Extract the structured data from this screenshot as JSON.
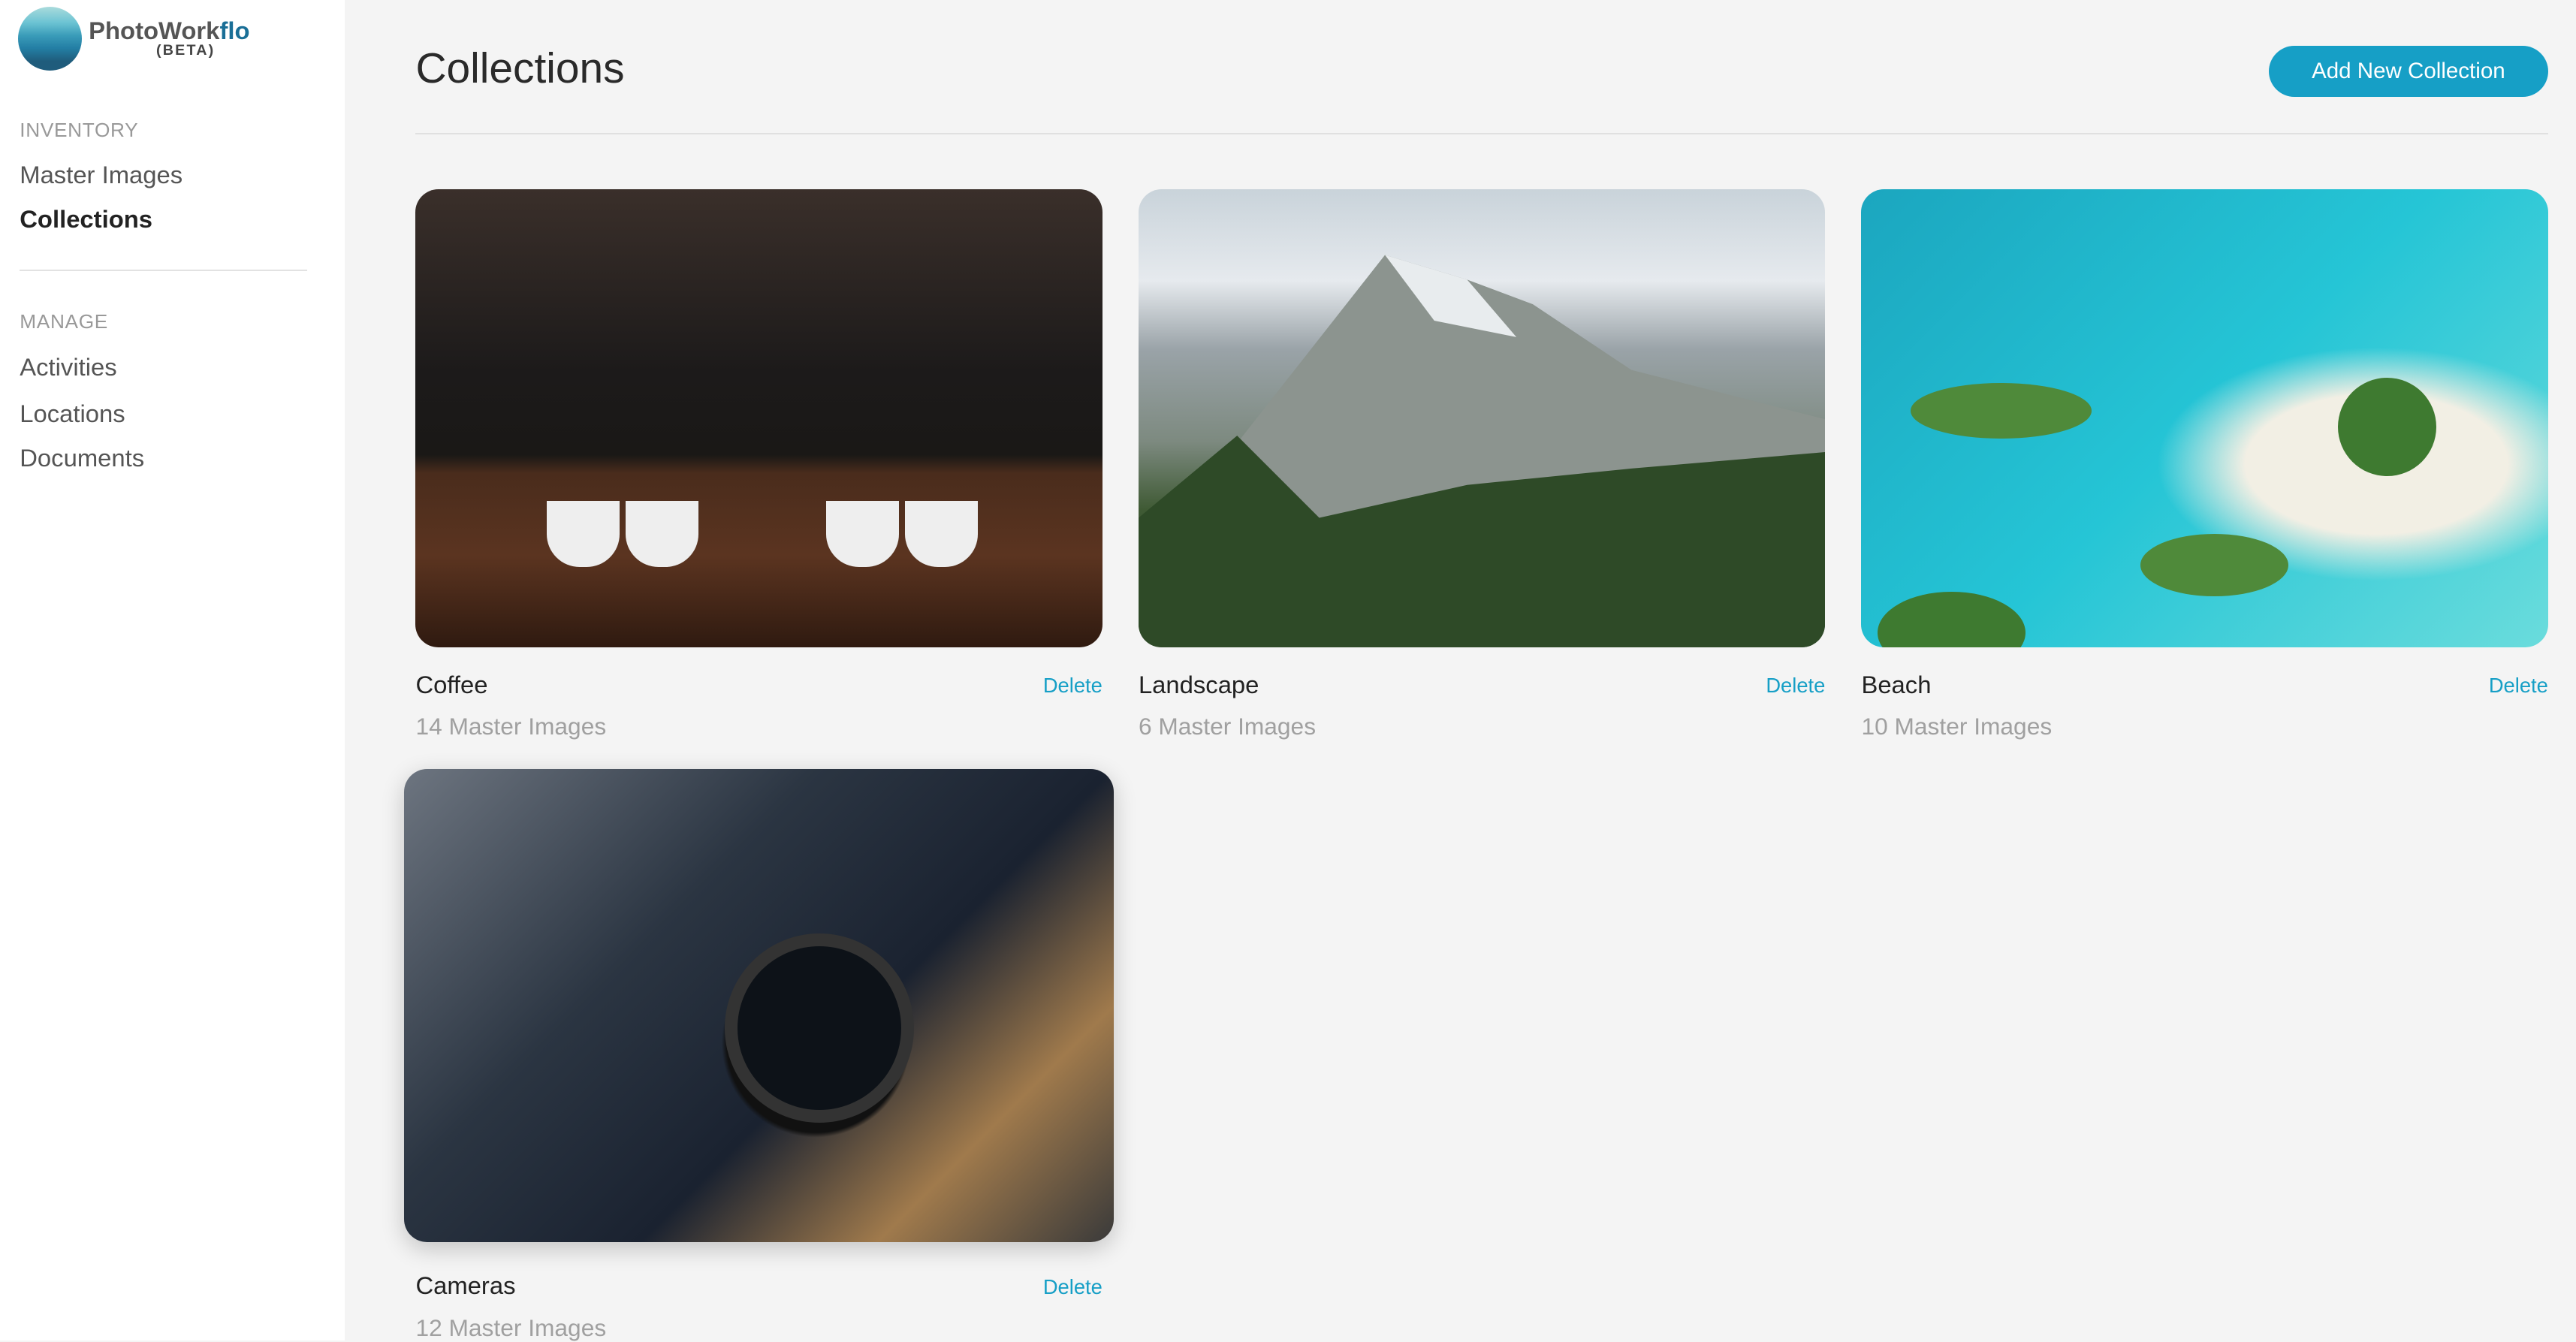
{
  "app": {
    "name_part1": "PhotoWork",
    "name_part2": "flo",
    "beta": "(BETA)"
  },
  "sidebar": {
    "sections": [
      {
        "title": "INVENTORY",
        "items": [
          {
            "label": "Master Images",
            "active": false
          },
          {
            "label": "Collections",
            "active": true
          }
        ]
      },
      {
        "title": "MANAGE",
        "items": [
          {
            "label": "Activities",
            "active": false
          },
          {
            "label": "Locations",
            "active": false
          },
          {
            "label": "Documents",
            "active": false
          }
        ]
      }
    ]
  },
  "header": {
    "title": "Collections",
    "add_button": "Add New Collection"
  },
  "colors": {
    "accent": "#169fc6"
  },
  "collections": [
    {
      "name": "Coffee",
      "count": "14 Master Images",
      "delete": "Delete"
    },
    {
      "name": "Landscape",
      "count": "6 Master Images",
      "delete": "Delete"
    },
    {
      "name": "Beach",
      "count": "10 Master Images",
      "delete": "Delete"
    },
    {
      "name": "Cameras",
      "count": "12 Master Images",
      "delete": "Delete"
    }
  ]
}
